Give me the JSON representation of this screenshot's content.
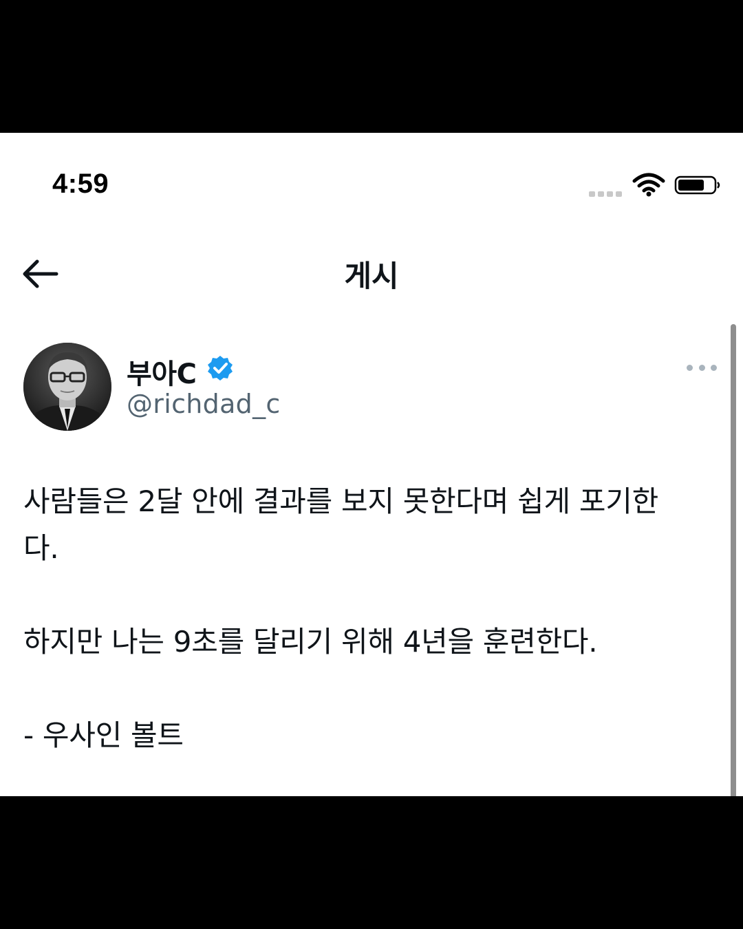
{
  "status_bar": {
    "time": "4:59"
  },
  "header": {
    "title": "게시"
  },
  "author": {
    "display_name": "부아C",
    "handle": "@richdad_c",
    "verified": true
  },
  "post": {
    "lines": [
      "사람들은 2달 안에 결과를 보지 못한다며 쉽게 포기한",
      "다.",
      "",
      "하지만 나는 9초를 달리기 위해 4년을 훈련한다.",
      "",
      "- 우사인 볼트"
    ]
  },
  "icons": {
    "back": "arrow-left-icon",
    "verified": "verified-badge-icon",
    "more": "more-horizontal-icon",
    "wifi": "wifi-icon",
    "battery": "battery-icon",
    "signal": "signal-dots-icon"
  },
  "colors": {
    "text": "#0f1419",
    "secondary": "#536471",
    "verified": "#1d9bf0"
  }
}
